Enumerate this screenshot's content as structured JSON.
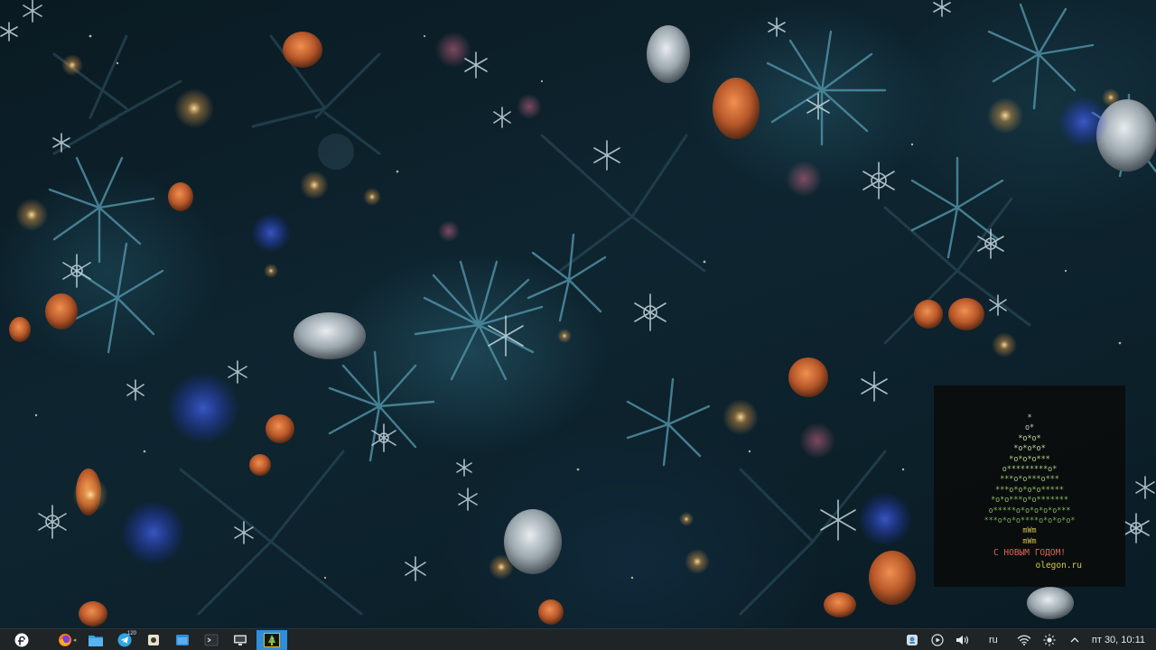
{
  "widget": {
    "tree_lines": [
      {
        "text": "*",
        "color": "#d9d9d9"
      },
      {
        "text": "o*",
        "color": "#d9d9d9"
      },
      {
        "text": "*o*o*",
        "color": "#cfe9a8"
      },
      {
        "text": "*o*o*o*",
        "color": "#c7e6a0"
      },
      {
        "text": "*o*o*o***",
        "color": "#bde090"
      },
      {
        "text": "o*********o*",
        "color": "#b3da85"
      },
      {
        "text": "***o*o***o***",
        "color": "#a9d47a"
      },
      {
        "text": "***o*o*o*o*****",
        "color": "#9fce70"
      },
      {
        "text": "*o*o***o*o*******",
        "color": "#95c866"
      },
      {
        "text": "o*****o*o*o*o*o***",
        "color": "#8bc25d"
      },
      {
        "text": "***o*o*o****o*o*o*o*",
        "color": "#81bc55"
      },
      {
        "text": "mWm",
        "color": "#e0c85a"
      },
      {
        "text": "mWm",
        "color": "#e0c85a"
      }
    ],
    "greeting": "С НОВЫМ ГОДОМ!",
    "site": "olegon.ru",
    "greeting_color": "#e86a5a",
    "site_color": "#e0d84a"
  },
  "taskbar": {
    "launcher_icon": "fedora-icon",
    "tasks": [
      {
        "name": "firefox-task",
        "icon": "firefox-icon"
      },
      {
        "name": "files-task",
        "icon": "folder-icon"
      },
      {
        "name": "telegram-task",
        "icon": "telegram-icon",
        "badge": "120"
      },
      {
        "name": "app-task",
        "icon": "generic-app-icon"
      },
      {
        "name": "window-task",
        "icon": "window-icon"
      },
      {
        "name": "terminal-task",
        "icon": "terminal-icon"
      },
      {
        "name": "monitor-task",
        "icon": "monitor-icon"
      },
      {
        "name": "tree-widget-task",
        "icon": "tree-widget-icon",
        "active": true
      }
    ],
    "keyboard_layout": "ru",
    "clock": "пт 30,  10:11",
    "accent": "#2f8ed8"
  }
}
